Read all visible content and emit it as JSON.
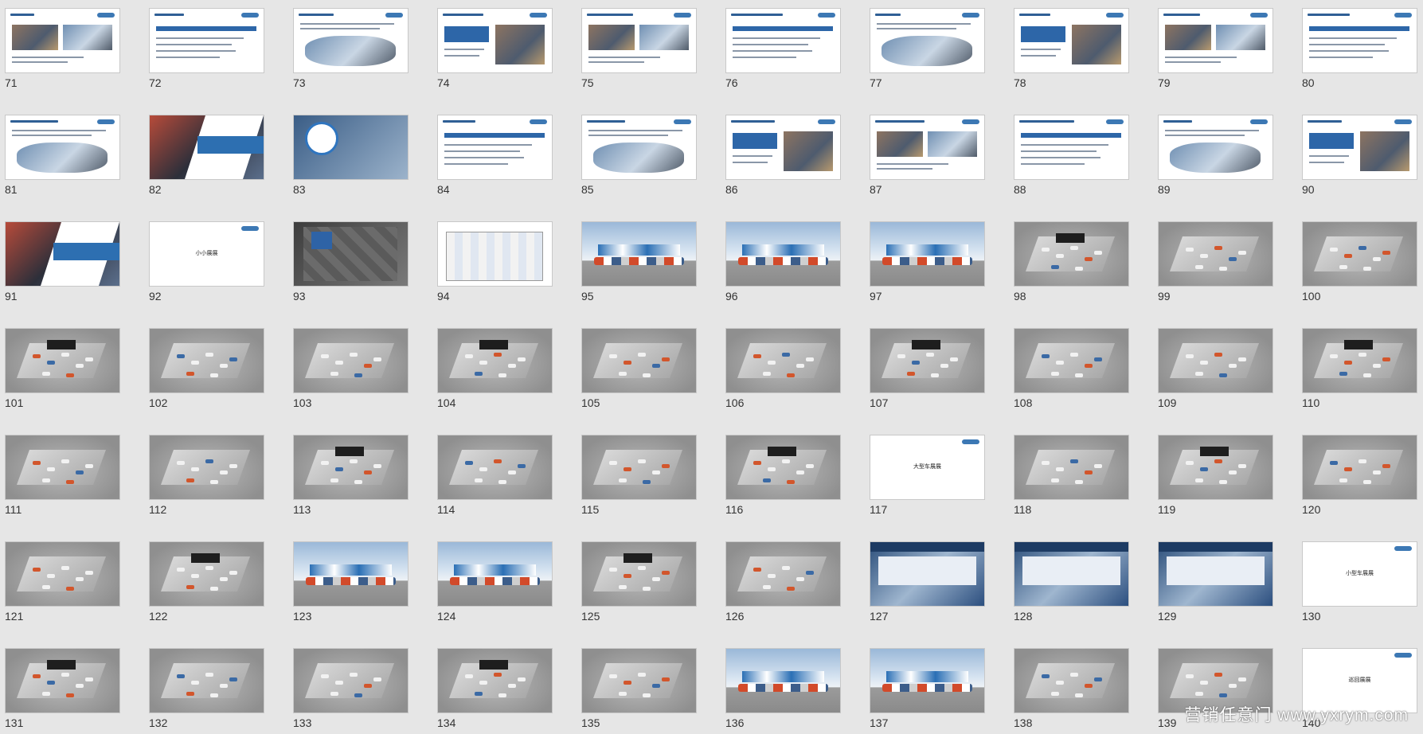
{
  "watermark": "营销任意门 www.yxrym.com",
  "slides": [
    {
      "n": "71",
      "kind": "text"
    },
    {
      "n": "72",
      "kind": "text"
    },
    {
      "n": "73",
      "kind": "text"
    },
    {
      "n": "74",
      "kind": "text"
    },
    {
      "n": "75",
      "kind": "text"
    },
    {
      "n": "76",
      "kind": "text"
    },
    {
      "n": "77",
      "kind": "text"
    },
    {
      "n": "78",
      "kind": "text"
    },
    {
      "n": "79",
      "kind": "text"
    },
    {
      "n": "80",
      "kind": "text"
    },
    {
      "n": "81",
      "kind": "text"
    },
    {
      "n": "82",
      "kind": "photo"
    },
    {
      "n": "83",
      "kind": "circle"
    },
    {
      "n": "84",
      "kind": "text"
    },
    {
      "n": "85",
      "kind": "text"
    },
    {
      "n": "86",
      "kind": "text"
    },
    {
      "n": "87",
      "kind": "text"
    },
    {
      "n": "88",
      "kind": "text"
    },
    {
      "n": "89",
      "kind": "text"
    },
    {
      "n": "90",
      "kind": "text"
    },
    {
      "n": "91",
      "kind": "photo"
    },
    {
      "n": "92",
      "kind": "title",
      "title": "小小展展"
    },
    {
      "n": "93",
      "kind": "plan3d"
    },
    {
      "n": "94",
      "kind": "plan"
    },
    {
      "n": "95",
      "kind": "sky"
    },
    {
      "n": "96",
      "kind": "sky"
    },
    {
      "n": "97",
      "kind": "sky"
    },
    {
      "n": "98",
      "kind": "gray"
    },
    {
      "n": "99",
      "kind": "gray"
    },
    {
      "n": "100",
      "kind": "gray"
    },
    {
      "n": "101",
      "kind": "gray"
    },
    {
      "n": "102",
      "kind": "gray"
    },
    {
      "n": "103",
      "kind": "gray"
    },
    {
      "n": "104",
      "kind": "gray"
    },
    {
      "n": "105",
      "kind": "gray"
    },
    {
      "n": "106",
      "kind": "gray"
    },
    {
      "n": "107",
      "kind": "gray"
    },
    {
      "n": "108",
      "kind": "gray"
    },
    {
      "n": "109",
      "kind": "gray"
    },
    {
      "n": "110",
      "kind": "gray"
    },
    {
      "n": "111",
      "kind": "gray"
    },
    {
      "n": "112",
      "kind": "gray"
    },
    {
      "n": "113",
      "kind": "gray"
    },
    {
      "n": "114",
      "kind": "gray"
    },
    {
      "n": "115",
      "kind": "gray"
    },
    {
      "n": "116",
      "kind": "gray"
    },
    {
      "n": "117",
      "kind": "title",
      "title": "大型车展展"
    },
    {
      "n": "118",
      "kind": "gray"
    },
    {
      "n": "119",
      "kind": "gray"
    },
    {
      "n": "120",
      "kind": "gray"
    },
    {
      "n": "121",
      "kind": "gray"
    },
    {
      "n": "122",
      "kind": "gray"
    },
    {
      "n": "123",
      "kind": "sky"
    },
    {
      "n": "124",
      "kind": "sky"
    },
    {
      "n": "125",
      "kind": "gray"
    },
    {
      "n": "126",
      "kind": "gray"
    },
    {
      "n": "127",
      "kind": "dark"
    },
    {
      "n": "128",
      "kind": "dark"
    },
    {
      "n": "129",
      "kind": "dark"
    },
    {
      "n": "130",
      "kind": "title",
      "title": "小型车展展"
    },
    {
      "n": "131",
      "kind": "gray"
    },
    {
      "n": "132",
      "kind": "gray"
    },
    {
      "n": "133",
      "kind": "gray"
    },
    {
      "n": "134",
      "kind": "gray"
    },
    {
      "n": "135",
      "kind": "gray"
    },
    {
      "n": "136",
      "kind": "sky"
    },
    {
      "n": "137",
      "kind": "sky"
    },
    {
      "n": "138",
      "kind": "gray"
    },
    {
      "n": "139",
      "kind": "gray"
    },
    {
      "n": "140",
      "kind": "title",
      "title": "巡回展展"
    }
  ]
}
